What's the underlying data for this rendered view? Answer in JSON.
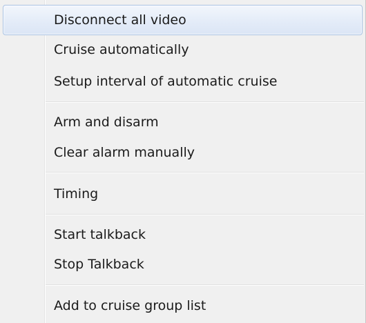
{
  "menu": {
    "items": [
      {
        "label": "Disconnect all video",
        "highlighted": true
      },
      {
        "label": "Cruise automatically"
      },
      {
        "label": "Setup interval of automatic cruise"
      },
      {
        "label": "Arm and disarm"
      },
      {
        "label": "Clear alarm manually"
      },
      {
        "label": "Timing"
      },
      {
        "label": "Start talkback"
      },
      {
        "label": "Stop Talkback"
      },
      {
        "label": "Add to cruise group list"
      }
    ]
  },
  "colors": {
    "menu_background": "#f0f0f0",
    "highlight_border": "#a9c2e3",
    "text": "#1a1a1a"
  }
}
